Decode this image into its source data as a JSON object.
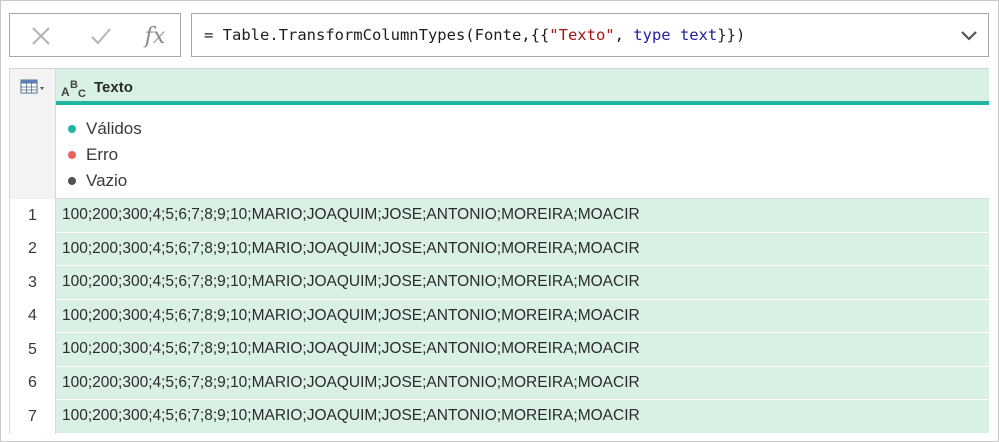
{
  "formula_bar": {
    "cancel_icon": "close-icon",
    "commit_icon": "check-icon",
    "function_label": "fx",
    "formula_parts": {
      "prefix": "= Table.TransformColumnTypes(Fonte,{{",
      "string": "\"Texto\"",
      "sep": ", ",
      "keyword": "type text",
      "suffix": "}})"
    },
    "expand_icon": "chevron-down-icon"
  },
  "table": {
    "column": {
      "type_icon": "abc-type-icon",
      "title": "Texto"
    },
    "quality": [
      {
        "label": "Válidos",
        "color": "#1fb5a0"
      },
      {
        "label": "Erro",
        "color": "#e8605a"
      },
      {
        "label": "Vazio",
        "color": "#505050"
      }
    ],
    "rows": [
      {
        "num": "1",
        "value": "100;200;300;4;5;6;7;8;9;10;MARIO;JOAQUIM;JOSE;ANTONIO;MOREIRA;MOACIR"
      },
      {
        "num": "2",
        "value": "100;200;300;4;5;6;7;8;9;10;MARIO;JOAQUIM;JOSE;ANTONIO;MOREIRA;MOACIR"
      },
      {
        "num": "3",
        "value": "100;200;300;4;5;6;7;8;9;10;MARIO;JOAQUIM;JOSE;ANTONIO;MOREIRA;MOACIR"
      },
      {
        "num": "4",
        "value": "100;200;300;4;5;6;7;8;9;10;MARIO;JOAQUIM;JOSE;ANTONIO;MOREIRA;MOACIR"
      },
      {
        "num": "5",
        "value": "100;200;300;4;5;6;7;8;9;10;MARIO;JOAQUIM;JOSE;ANTONIO;MOREIRA;MOACIR"
      },
      {
        "num": "6",
        "value": "100;200;300;4;5;6;7;8;9;10;MARIO;JOAQUIM;JOSE;ANTONIO;MOREIRA;MOACIR"
      },
      {
        "num": "7",
        "value": "100;200;300;4;5;6;7;8;9;10;MARIO;JOAQUIM;JOSE;ANTONIO;MOREIRA;MOACIR"
      }
    ]
  }
}
